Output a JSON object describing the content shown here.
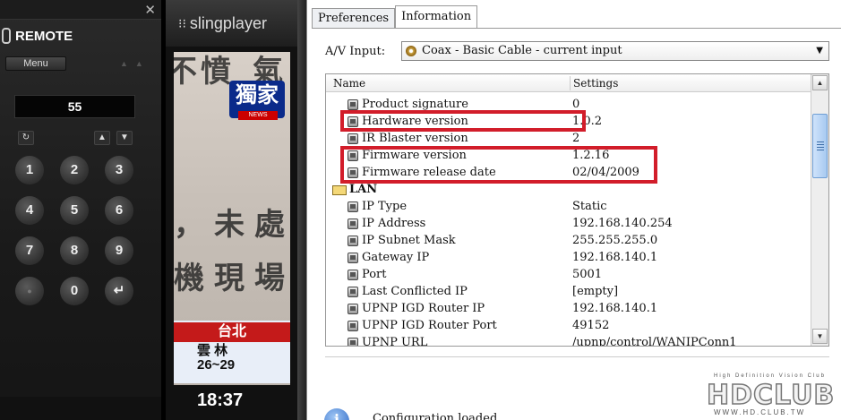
{
  "remote": {
    "title": "REMOTE",
    "close": "✕",
    "menu_label": "Menu",
    "menu_arrows": "▲▲",
    "display_value": "55",
    "refresh_glyph": "↻",
    "up_glyph": "▲",
    "down_glyph": "▼",
    "keys": [
      "1",
      "2",
      "3",
      "4",
      "5",
      "6",
      "7",
      "8",
      "9",
      "●",
      "0",
      "↵"
    ]
  },
  "sling": {
    "title": "slingplayer",
    "icon_glyph": "⁝⁝",
    "video": {
      "logo": "獨家",
      "logo_sub": "NEWS",
      "city": "台北",
      "weather_place": "雲 林",
      "temp": "26~29",
      "time": "18:37",
      "chars": [
        "不",
        "憤",
        "氣",
        "，",
        "未",
        "處",
        "機",
        "現",
        "場"
      ]
    }
  },
  "dialog": {
    "tabs": [
      "Preferences",
      "Information"
    ],
    "active_tab": "Information",
    "av_input_label": "A/V Input:",
    "av_input_value": "Coax - Basic Cable - current input",
    "columns": {
      "name": "Name",
      "settings": "Settings"
    },
    "rows_top": [
      {
        "name": "Product signature",
        "value": "0"
      },
      {
        "name": "Hardware version",
        "value": "1.0.2"
      },
      {
        "name": "IR Blaster version",
        "value": "2"
      },
      {
        "name": "Firmware version",
        "value": "1.2.16"
      },
      {
        "name": "Firmware release date",
        "value": "02/04/2009"
      }
    ],
    "group": "LAN",
    "rows_lan": [
      {
        "name": "IP Type",
        "value": "Static"
      },
      {
        "name": "IP Address",
        "value": "192.168.140.254"
      },
      {
        "name": "IP Subnet Mask",
        "value": "255.255.255.0"
      },
      {
        "name": "Gateway IP",
        "value": "192.168.140.1"
      },
      {
        "name": "Port",
        "value": "5001"
      },
      {
        "name": "Last Conflicted IP",
        "value": "[empty]"
      },
      {
        "name": "UPNP IGD Router IP",
        "value": "192.168.140.1"
      },
      {
        "name": "UPNP IGD Router Port",
        "value": "49152"
      },
      {
        "name": "UPNP URL",
        "value": "/upnp/control/WANIPConn1"
      }
    ],
    "status_icon": "i",
    "status_text": "Configuration loaded",
    "highlight_color": "#d21d2a"
  },
  "watermark": {
    "tag": "High Definition Vision Club",
    "logo": "HDCLUB",
    "url": "WWW.HD.CLUB.TW"
  }
}
